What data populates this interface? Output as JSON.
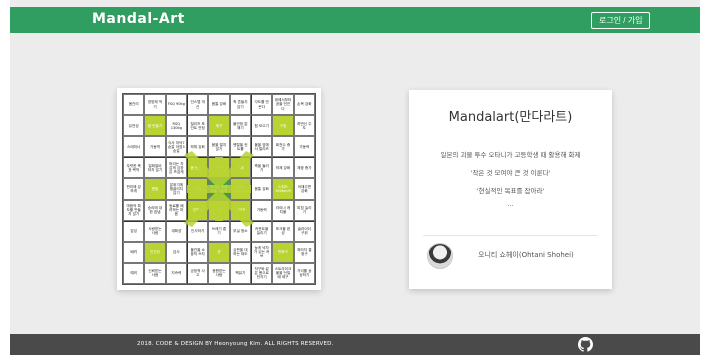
{
  "header": {
    "logo": "Mandal-Art",
    "login_label": "로그인 / 가입",
    "color": "#2f9e60"
  },
  "mandalart": {
    "center": "8구단 드래프트 1순위",
    "rows": [
      [
        "몸관리",
        "영양제 먹기",
        "FSQ 90kg",
        "인스텝 개선",
        "몸통 강화",
        "축 흔들지 않기",
        "각도를 만든다",
        "위에서부터 공을 던진다",
        "손목 강화"
      ],
      [
        "유연성",
        "몸 만들기",
        "RSQ 130kg",
        "릴리즈 포인트 안정",
        "제구",
        "불안정 없애기",
        "힘 모으기",
        "구위",
        "하반신 주도"
      ],
      [
        "스태미너",
        "가동역",
        "식사 저녁7숟갈 아침3숟갈",
        "하체 강화",
        "몸을 열지 않기",
        "멘탈을 컨트롤",
        "볼을 앞에서 릴리즈",
        "회전수 증가",
        "가동력"
      ],
      [
        "뚜렷한 목표·목적",
        "일희일비 하지 않기",
        "머리는 차갑게 심장은 뜨겁게",
        "몸 만들기",
        "제구",
        "구위",
        "축을 돌리기",
        "하체 강화",
        "체중 증가"
      ],
      [
        "핀치에 강하게",
        "멘탈",
        "분위기에 휩쓸리지 않기",
        "멘탈",
        "8구단 드래프트 1순위",
        "스피드 160km/h",
        "몸통 강화",
        "스피드 160km/h",
        "어깨주변 강화"
      ],
      [
        "마음의 파도를 만들지 않기",
        "승리에 대한 집념",
        "동료를 배려하는 마음",
        "인간성",
        "운",
        "변화구",
        "가동력",
        "라이너 캐치볼",
        "피칭 늘리기"
      ],
      [
        "감성",
        "사랑받는 사람",
        "계획성",
        "인사하기",
        "쓰레기 줍기",
        "부실 청소",
        "카운트볼 늘리기",
        "포크볼 완성",
        "슬라이더 구위"
      ],
      [
        "배려",
        "인간성",
        "감사",
        "물건을 소중히 쓰자",
        "운",
        "심판을 대하는 태도",
        "늦게 낙차가 있는 커브",
        "변화구",
        "좌타자 결정구"
      ],
      [
        "예의",
        "신뢰받는 사람",
        "지속력",
        "긍정적 사고",
        "응원받는 사람",
        "책읽기",
        "직구와 같은 폼으로 던지기",
        "스트라이크 볼을 던질 때 제구",
        "거리를 상상하기"
      ]
    ]
  },
  "card": {
    "title": "Mandalart(만다라트)",
    "line1": "일본의 괴물 투수 오타니가 고등학생 때 활용해 화제",
    "line2": "'작은 것 모여야 큰 것 이룬다'",
    "line3": "'현실적인 목표를 잡아라'",
    "line4": "...",
    "author": "오니티 쇼헤이(Ohtani Shohei)"
  },
  "footer": {
    "copyright": "2018. CODE & DESIGN BY Heonyoung Kim. ALL RIGHTS RESERVED.",
    "github_icon": "github-icon"
  },
  "colors": {
    "accent": "#2f9e60",
    "cell_highlight": "#b8d332",
    "cell_center": "#3f9e3f",
    "footer": "#4a4a4a"
  }
}
